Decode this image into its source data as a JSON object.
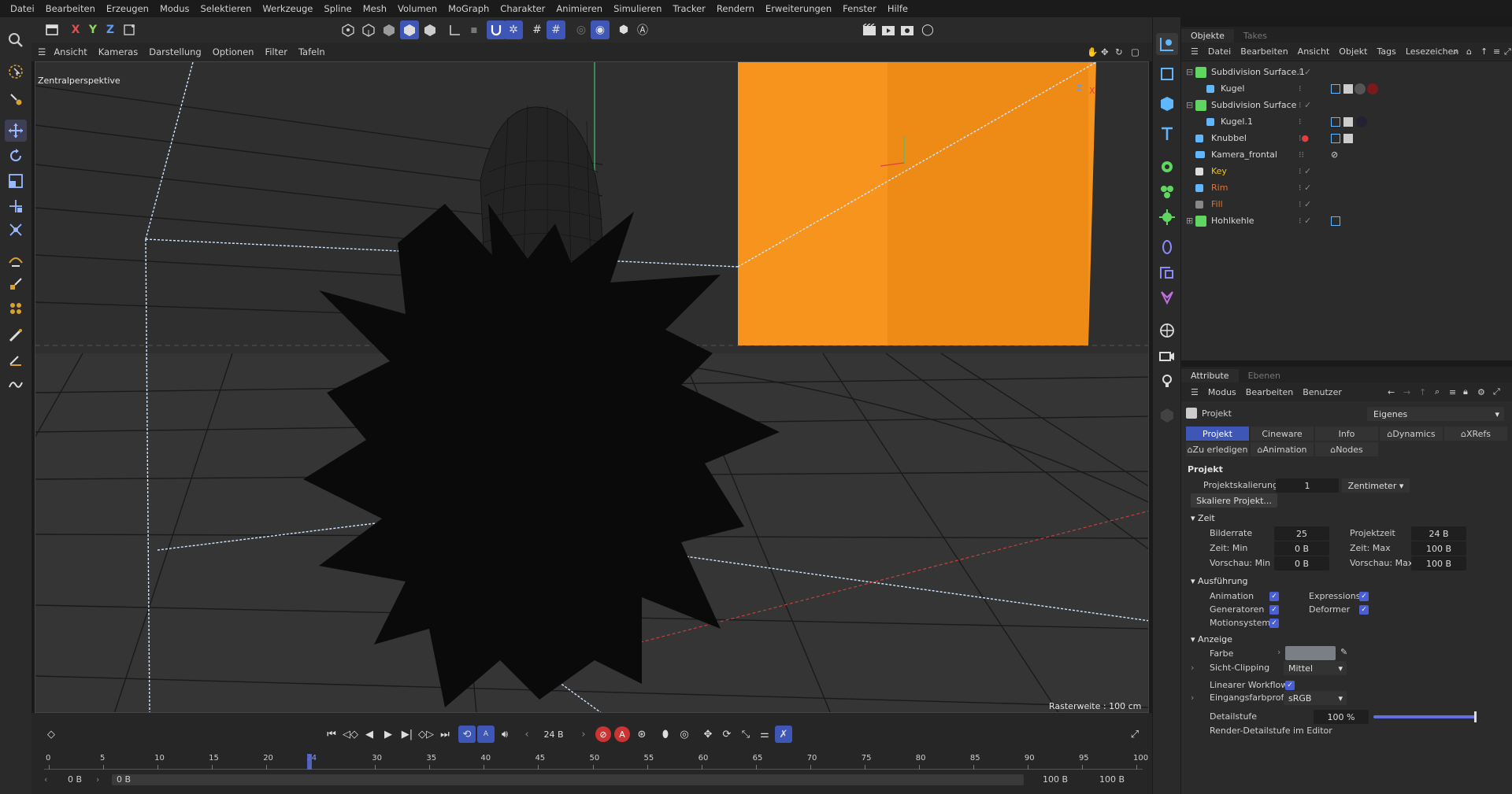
{
  "menubar": [
    "Datei",
    "Bearbeiten",
    "Erzeugen",
    "Modus",
    "Selektieren",
    "Werkzeuge",
    "Spline",
    "Mesh",
    "Volumen",
    "MoGraph",
    "Charakter",
    "Animieren",
    "Simulieren",
    "Tracker",
    "Rendern",
    "Erweiterungen",
    "Fenster",
    "Hilfe"
  ],
  "toolbar": {
    "x": "X",
    "y": "Y",
    "z": "Z"
  },
  "viewport": {
    "menu": [
      "Ansicht",
      "Kameras",
      "Darstellung",
      "Optionen",
      "Filter",
      "Tafeln"
    ],
    "label": "Zentralperspektive",
    "grid_info": "Rasterweite : 100 cm",
    "axis_z": "Z",
    "axis_x": "X"
  },
  "objects_panel": {
    "tabs": [
      "Objekte",
      "Takes"
    ],
    "menu": [
      "Datei",
      "Bearbeiten",
      "Ansicht",
      "Objekt",
      "Tags",
      "Lesezeichen"
    ],
    "items": [
      {
        "name": "Subdivision Surface.1",
        "color": "#cfcfcf"
      },
      {
        "name": "Kugel",
        "color": "#cfcfcf"
      },
      {
        "name": "Subdivision Surface",
        "color": "#cfcfcf"
      },
      {
        "name": "Kugel.1",
        "color": "#cfcfcf"
      },
      {
        "name": "Knubbel",
        "color": "#cfcfcf"
      },
      {
        "name": "Kamera_frontal",
        "color": "#cfcfcf"
      },
      {
        "name": "Key",
        "color": "#f0c020"
      },
      {
        "name": "Rim",
        "color": "#e8702a"
      },
      {
        "name": "Fill",
        "color": "#e8702a"
      },
      {
        "name": "Hohlkehle",
        "color": "#cfcfcf"
      }
    ]
  },
  "attributes": {
    "tabs": [
      "Attribute",
      "Ebenen"
    ],
    "menu": [
      "Modus",
      "Bearbeiten",
      "Benutzer"
    ],
    "object": "Projekt",
    "preset": "Eigenes",
    "ptabs": [
      "Projekt",
      "Cineware",
      "Info",
      "Dynamics",
      "XRefs"
    ],
    "ptabs2": [
      "Zu erledigen",
      "Animation",
      "Nodes"
    ],
    "section_title": "Projekt",
    "projektskalierung_label": "Projektskalierung",
    "projektskalierung_value": "1",
    "unit": "Zentimeter",
    "scale_button": "Skaliere Projekt...",
    "zeit": "Zeit",
    "bilderrate_label": "Bilderrate",
    "bilderrate": "25",
    "projektzeit_label": "Projektzeit",
    "projektzeit": "24 B",
    "zeit_min_label": "Zeit: Min",
    "zeit_min": "0 B",
    "zeit_max_label": "Zeit: Max",
    "zeit_max": "100 B",
    "vorschau_min_label": "Vorschau: Min",
    "vorschau_min": "0 B",
    "vorschau_max_label": "Vorschau: Max",
    "vorschau_max": "100 B",
    "ausfuehrung": "Ausführung",
    "animation": "Animation",
    "expressions": "Expressions",
    "generatoren": "Generatoren",
    "deformer": "Deformer",
    "motionsystem": "Motionsystem",
    "anzeige": "Anzeige",
    "farbe": "Farbe",
    "sicht_clipping": "Sicht-Clipping",
    "sicht_value": "Mittel",
    "linearer_workflow": "Linearer Workflow",
    "eingangsfarbprofil": "Eingangsfarbprofil",
    "farbprofil_value": "sRGB",
    "detailstufe": "Detailstufe",
    "detailstufe_value": "100 %",
    "render_detail": "Render-Detailstufe im Editor"
  },
  "timeline": {
    "current_frame": "24 B",
    "ticks": [
      "0",
      "5",
      "10",
      "15",
      "20",
      "24",
      "30",
      "35",
      "40",
      "45",
      "50",
      "55",
      "60",
      "65",
      "70",
      "75",
      "80",
      "85",
      "90",
      "95",
      "100"
    ],
    "start_a": "0 B",
    "start_b": "0 B",
    "end_a": "100 B",
    "end_b": "100 B",
    "current_frame_value": 24
  },
  "colors": {
    "accent": "#3e56b5",
    "orange_plane": "#f7941d"
  }
}
